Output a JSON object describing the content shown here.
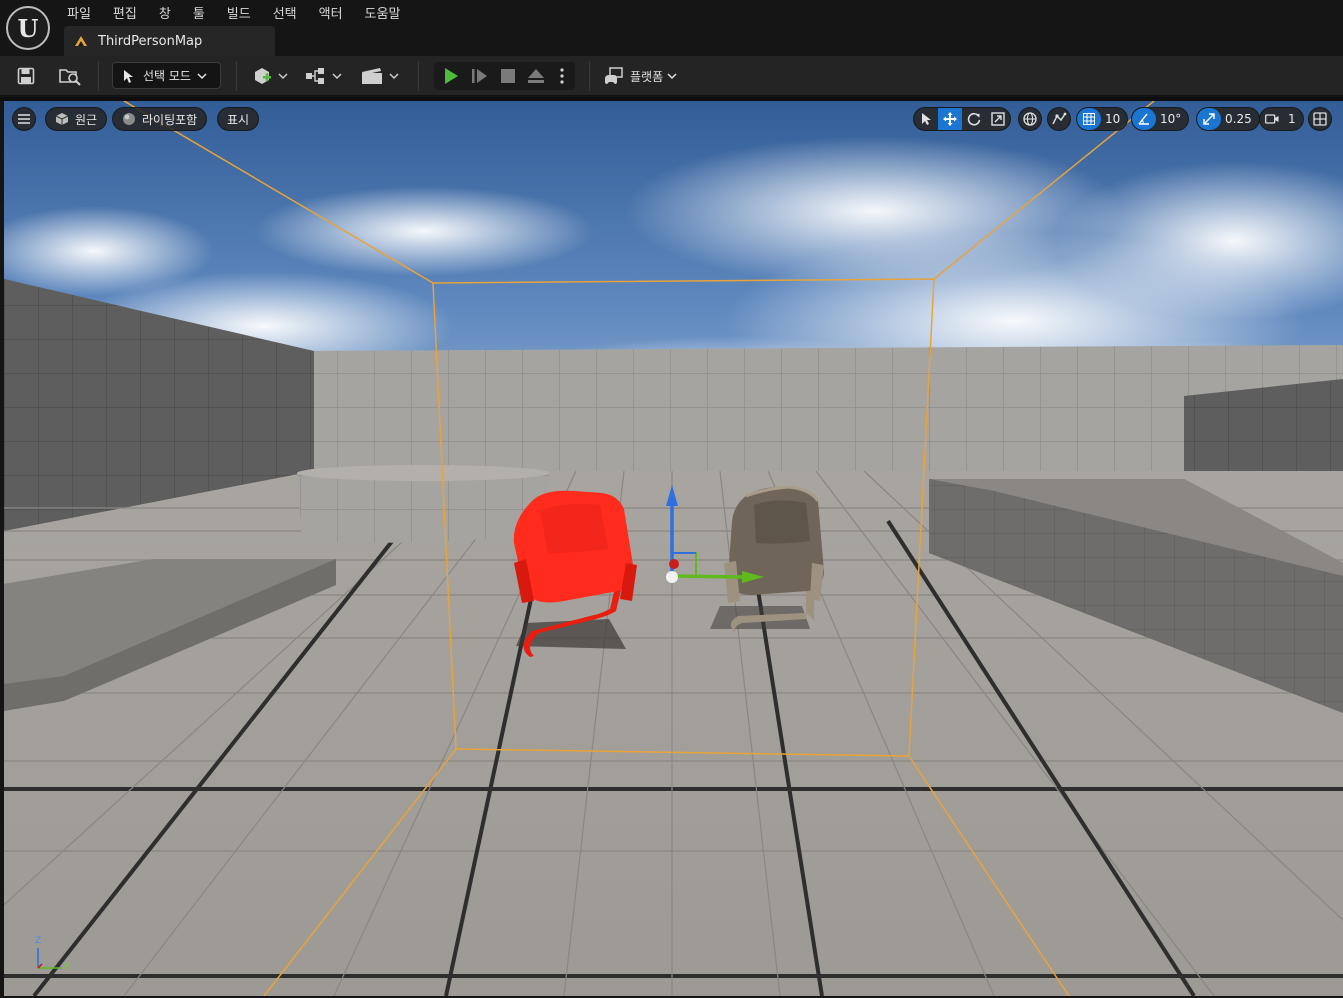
{
  "app": {
    "logo_text": "U",
    "menu": [
      "파일",
      "편집",
      "창",
      "툴",
      "빌드",
      "선택",
      "액터",
      "도움말"
    ],
    "document_tab": "ThirdPersonMap"
  },
  "toolbar": {
    "save_icon": "save-icon",
    "browse_icon": "content-browser-icon",
    "mode_label": "선택 모드",
    "platform_label": "플랫폼",
    "play_color": "#4fbb3c"
  },
  "viewport": {
    "perspective_label": "원근",
    "lighting_label": "라이팅포함",
    "show_label": "표시",
    "grid_snap_value": "10",
    "rotation_snap_value": "10°",
    "scale_snap_value": "0.25",
    "camera_speed_value": "1",
    "axis_labels": {
      "z": "Z",
      "y": "Y"
    },
    "colors": {
      "selection_box": "#e8a33a",
      "red_chair": "#ff2b1c",
      "gray_chair": "#6f6558",
      "accent": "#1a76d2",
      "gizmo_z": "#2f6fe0",
      "gizmo_y": "#5fba1e",
      "gizmo_x": "#c81e1e"
    }
  }
}
